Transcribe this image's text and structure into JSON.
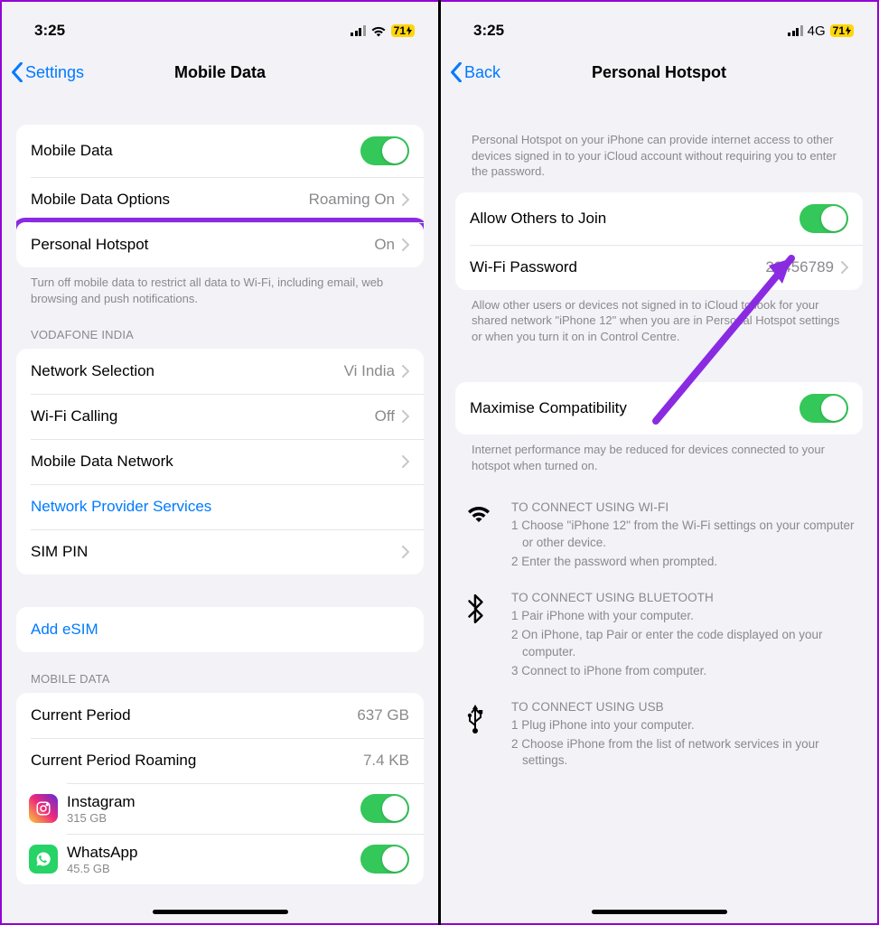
{
  "left": {
    "status": {
      "time": "3:25",
      "network_type": "wifi",
      "battery": "71"
    },
    "nav": {
      "back": "Settings",
      "title": "Mobile Data"
    },
    "group1": {
      "mobile_data": "Mobile Data",
      "mobile_data_options": "Mobile Data Options",
      "mobile_data_options_val": "Roaming On",
      "personal_hotspot": "Personal Hotspot",
      "personal_hotspot_val": "On"
    },
    "note1": "Turn off mobile data to restrict all data to Wi-Fi, including email, web browsing and push notifications.",
    "carrier_header": "VODAFONE INDIA",
    "group2": {
      "network_selection": "Network Selection",
      "network_selection_val": "Vi India",
      "wifi_calling": "Wi-Fi Calling",
      "wifi_calling_val": "Off",
      "mobile_data_network": "Mobile Data Network",
      "network_provider_services": "Network Provider Services",
      "sim_pin": "SIM PIN"
    },
    "group3": {
      "add_esim": "Add eSIM"
    },
    "usage_header": "MOBILE DATA",
    "group4": {
      "current_period": "Current Period",
      "current_period_val": "637 GB",
      "current_roaming": "Current Period Roaming",
      "current_roaming_val": "7.4 KB",
      "app1_name": "Instagram",
      "app1_sub": "315 GB",
      "app2_name": "WhatsApp",
      "app2_sub": "45.5 GB"
    }
  },
  "right": {
    "status": {
      "time": "3:25",
      "network_type": "4G",
      "battery": "71"
    },
    "nav": {
      "back": "Back",
      "title": "Personal Hotspot"
    },
    "intro": "Personal Hotspot on your iPhone can provide internet access to other devices signed in to your iCloud account without requiring you to enter the password.",
    "group1": {
      "allow_others": "Allow Others to Join",
      "wifi_password": "Wi-Fi Password",
      "wifi_password_val": "23456789"
    },
    "note2": "Allow other users or devices not signed in to iCloud to look for your shared network \"iPhone 12\" when you are in Personal Hotspot settings or when you turn it on in Control Centre.",
    "group2": {
      "maximise": "Maximise Compatibility"
    },
    "note3": "Internet performance may be reduced for devices connected to your hotspot when turned on.",
    "instr_wifi": {
      "title": "TO CONNECT USING WI-FI",
      "l1": "1 Choose \"iPhone 12\" from the Wi-Fi settings on your computer or other device.",
      "l2": "2 Enter the password when prompted."
    },
    "instr_bt": {
      "title": "TO CONNECT USING BLUETOOTH",
      "l1": "1 Pair iPhone with your computer.",
      "l2": "2 On iPhone, tap Pair or enter the code displayed on your computer.",
      "l3": "3 Connect to iPhone from computer."
    },
    "instr_usb": {
      "title": "TO CONNECT USING USB",
      "l1": "1 Plug iPhone into your computer.",
      "l2": "2 Choose iPhone from the list of network services in your settings."
    }
  }
}
